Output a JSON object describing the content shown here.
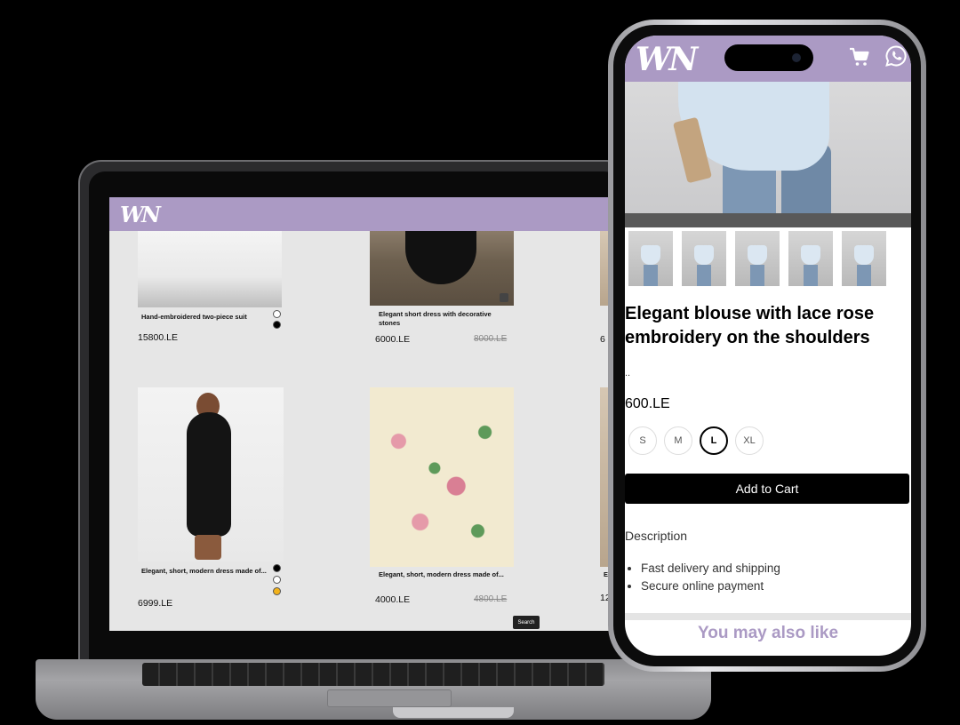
{
  "brand": {
    "logo_text": "WN",
    "accent_color": "#ab9ac4"
  },
  "desktop": {
    "products": [
      {
        "title": "Hand-embroidered two-piece suit",
        "price": "15800.LE",
        "old_price": "",
        "colors": [
          "#ffffff",
          "#000000"
        ]
      },
      {
        "title": "Elegant short dress with decorative stones",
        "price": "6000.LE",
        "old_price": "8000.LE",
        "colors": []
      },
      {
        "title": "Elegant, short, modern dress made of...",
        "price": "6999.LE",
        "old_price": "",
        "colors": [
          "#000000",
          "#ffffff",
          "#f2b21b"
        ]
      },
      {
        "title": "Elegant, short, modern dress made of...",
        "price": "4000.LE",
        "old_price": "4800.LE",
        "colors": []
      }
    ],
    "partial_price_1": "6",
    "partial_title_2": "E",
    "partial_price_2": "12",
    "search_label": "Search"
  },
  "mobile": {
    "icons": [
      "shopping-cart-icon",
      "whatsapp-icon"
    ],
    "product_title": "Elegant blouse with lace rose embroidery on the shoulders",
    "short_desc": "..",
    "price": "600.LE",
    "sizes": [
      "S",
      "M",
      "L",
      "XL"
    ],
    "selected_size": "L",
    "add_to_cart_label": "Add to Cart",
    "description_label": "Description",
    "features": [
      "Fast delivery and shipping",
      "Secure online payment"
    ],
    "you_may_like": "You may also like"
  }
}
